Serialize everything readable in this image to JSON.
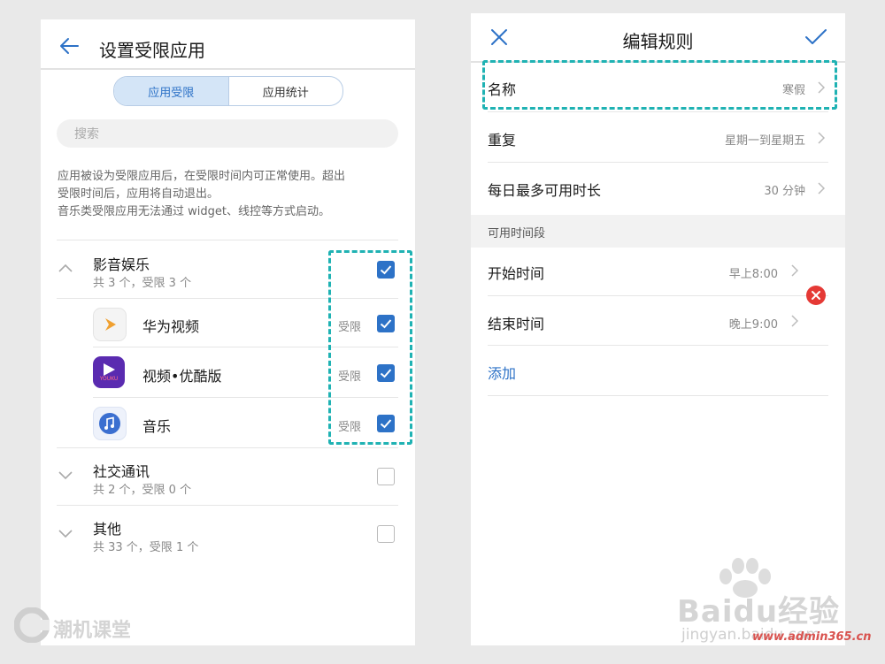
{
  "left_screen": {
    "title": "设置受限应用",
    "tabs": [
      "应用受限",
      "应用统计"
    ],
    "search_placeholder": "搜索",
    "description": [
      "应用被设为受限应用后，在受限时间内可正常使用。超出",
      "受限时间后，应用将自动退出。",
      "音乐类受限应用无法通过 widget、线控等方式启动。"
    ],
    "groups": [
      {
        "name": "影音娱乐",
        "summary": "共 3 个，受限 3 个",
        "checked": true,
        "apps": [
          {
            "name": "华为视频",
            "status": "受限",
            "checked": true,
            "icon": "huawei-video-icon"
          },
          {
            "name": "视频•优酷版",
            "status": "受限",
            "checked": true,
            "icon": "youku-icon"
          },
          {
            "name": "音乐",
            "status": "受限",
            "checked": true,
            "icon": "music-icon"
          }
        ]
      },
      {
        "name": "社交通讯",
        "summary": "共 2 个，受限 0 个",
        "checked": false
      },
      {
        "name": "其他",
        "summary": "共 33 个，受限 1 个",
        "checked": false
      }
    ],
    "youku_badge": "YOUKU"
  },
  "right_screen": {
    "title": "编辑规则",
    "rows": [
      {
        "label": "名称",
        "value": "寒假"
      },
      {
        "label": "重复",
        "value": "星期一到星期五"
      },
      {
        "label": "每日最多可用时长",
        "value": "30 分钟"
      }
    ],
    "section_title": "可用时间段",
    "time_rows": [
      {
        "label": "开始时间",
        "value": "早上8:00"
      },
      {
        "label": "结束时间",
        "value": "晚上9:00"
      }
    ],
    "add_label": "添加"
  },
  "watermarks": {
    "brand": "潮机课堂",
    "baidu": "Baidu经验",
    "jingyan": "jingyan.baidu.com",
    "site": "www.admin365.cn"
  },
  "colors": {
    "accent": "#2d72c7",
    "dash": "#1fb2b3",
    "delete": "#e53935"
  }
}
